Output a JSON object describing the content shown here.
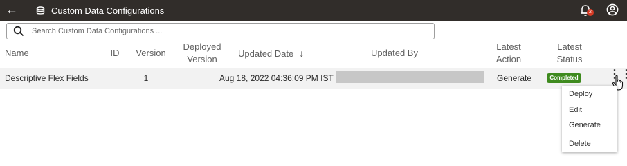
{
  "app": {
    "title": "Custom Data Configurations",
    "notification_count": "2"
  },
  "search": {
    "placeholder": "Search Custom Data Configurations ..."
  },
  "table": {
    "headers": {
      "name": "Name",
      "id": "ID",
      "version": "Version",
      "deployed_version_line1": "Deployed",
      "deployed_version_line2": "Version",
      "updated_date": "Updated Date",
      "updated_by": "Updated By",
      "latest_action_line1": "Latest",
      "latest_action_line2": "Action",
      "latest_status_line1": "Latest",
      "latest_status_line2": "Status"
    },
    "sort": {
      "column": "updated_date",
      "direction": "descending"
    },
    "rows": [
      {
        "name": "Descriptive Flex Fields",
        "id": "",
        "version": "1",
        "deployed_version": "",
        "updated_date": "Aug 18, 2022 04:36:09 PM IST",
        "updated_by": "",
        "latest_action": "Generate",
        "latest_status": "Completed"
      }
    ]
  },
  "row_menu": {
    "items": [
      "Deploy",
      "Edit",
      "Generate",
      "Delete"
    ]
  },
  "colors": {
    "header_bg": "#312d2a",
    "status_completed": "#3e8a1e",
    "notification_badge": "#d63b25"
  }
}
